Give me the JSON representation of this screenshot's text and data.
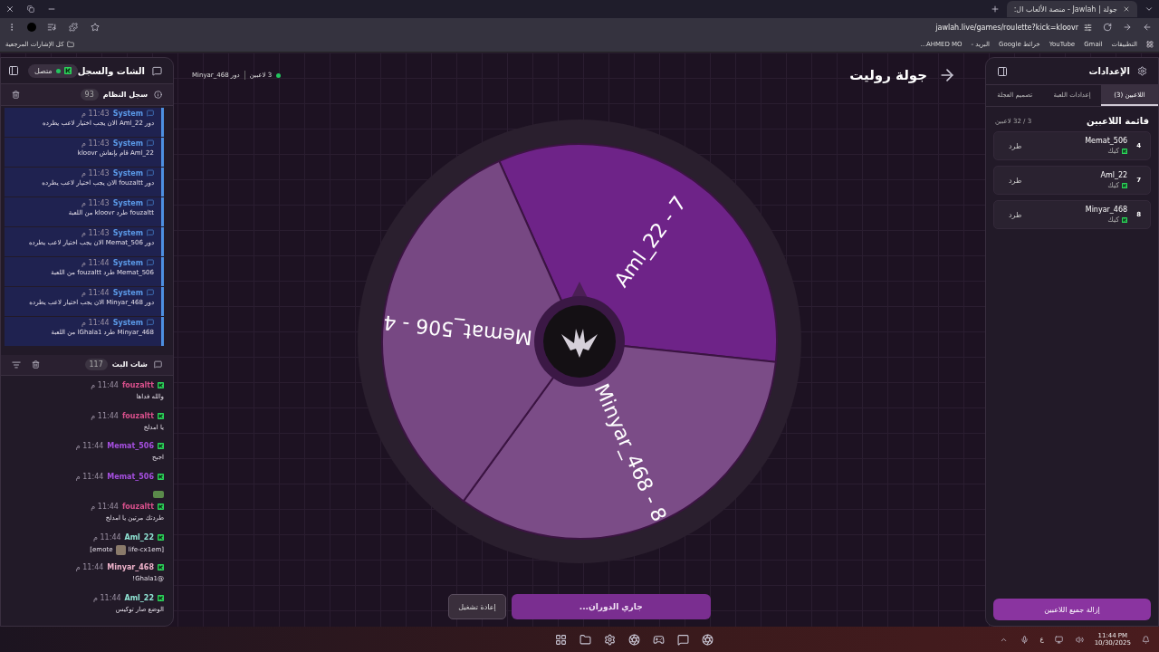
{
  "browser": {
    "tabs": [
      {
        "title": "جولة | Jawlah - منصة الألعاب ال:",
        "selected": true
      }
    ],
    "url": "jawlah.live/games/roulette?kick=kloovr",
    "bookmarks": [
      "التطبيقات",
      "Gmail",
      "YouTube",
      "خرائط Google",
      "البريد -",
      "AHMED MO..."
    ],
    "all_bookmarks": "كل الإشارات المرجعية"
  },
  "left_panel": {
    "title": "الشات والسجل",
    "status": "متصل",
    "system_log": {
      "title": "سجل النظام",
      "count": "93",
      "entries": [
        {
          "author": "System",
          "time": "11:43 م",
          "text": "دور Aml_22 الان يجب اختيار لاعب يطرده"
        },
        {
          "author": "System",
          "time": "11:43 م",
          "text": "Aml_22 قام بإنعاش kloovr"
        },
        {
          "author": "System",
          "time": "11:43 م",
          "text": "دور fouzaltt الان يجب اختيار لاعب يطرده"
        },
        {
          "author": "System",
          "time": "11:43 م",
          "text": "fouzaltt طرد kloovr من اللعبة"
        },
        {
          "author": "System",
          "time": "11:43 م",
          "text": "دور Memat_506 الان يجب اختيار لاعب يطرده"
        },
        {
          "author": "System",
          "time": "11:44 م",
          "text": "Memat_506 طرد fouzaltt من اللعبة"
        },
        {
          "author": "System",
          "time": "11:44 م",
          "text": "دور Minyar_468 الان يجب اختيار لاعب يطرده"
        },
        {
          "author": "System",
          "time": "11:44 م",
          "text": "Minyar_468 طرد lGhala1 من اللعبة"
        }
      ]
    },
    "chat": {
      "title": "شات البث",
      "count": "117",
      "messages": [
        {
          "kind": "text",
          "author": "fouzaltt",
          "color": "#d9508c",
          "time": "11:44 م",
          "text": "والله فداها"
        },
        {
          "kind": "text",
          "author": "fouzaltt",
          "color": "#d9508c",
          "time": "11:44 م",
          "text": "يا امدلخ"
        },
        {
          "kind": "text",
          "author": "Memat_506",
          "color": "#a64fe0",
          "time": "11:44 م",
          "text": "اجبح"
        },
        {
          "kind": "emote",
          "author": "Memat_506",
          "color": "#a64fe0",
          "time": "11:44 م"
        },
        {
          "kind": "text",
          "author": "fouzaltt",
          "color": "#d9508c",
          "time": "11:44 م",
          "text": "طردتك مرتين يا امدلخ"
        },
        {
          "kind": "emote_text",
          "author": "Aml_22",
          "color": "#8fe3d3",
          "time": "11:44 م",
          "before": "[emote",
          "after": "life-cx1em]"
        },
        {
          "kind": "text",
          "author": "Minyar_468",
          "color": "#f0b4cc",
          "time": "11:44 م",
          "text": "@Ghala1!"
        },
        {
          "kind": "text",
          "author": "Aml_22",
          "color": "#8fe3d3",
          "time": "11:44 م",
          "text": "الوضع صار توكيس"
        }
      ]
    }
  },
  "center": {
    "title": "جولة روليت",
    "players_count": "3 لاعبين",
    "turn": "دور Minyar_468",
    "wheel": {
      "segments": [
        {
          "label": "Aml_22 - 7",
          "color": "#6e2388"
        },
        {
          "label": "Minyar_468 - 8",
          "color": "#7b4c87"
        },
        {
          "label": "Memat_506 - 4",
          "color": "#774883"
        }
      ]
    },
    "restart_button": "إعادة تشغيل",
    "spin_button": "جاري الدوران..."
  },
  "right_panel": {
    "title": "الإعدادات",
    "tabs": [
      {
        "label": "اللاعبين (3)",
        "selected": true
      },
      {
        "label": "إعدادات اللعبة",
        "selected": false
      },
      {
        "label": "تصميم العجلة",
        "selected": false
      }
    ],
    "list_title": "قائمة اللاعبين",
    "capacity": "3 / 32 لاعبين",
    "players": [
      {
        "number": "4",
        "name": "Memat_506",
        "platform": "كيك",
        "action": "طرد"
      },
      {
        "number": "7",
        "name": "Aml_22",
        "platform": "كيك",
        "action": "طرد"
      },
      {
        "number": "8",
        "name": "Minyar_468",
        "platform": "كيك",
        "action": "طرد"
      }
    ],
    "remove_all": "إزالة جميع اللاعبين"
  },
  "taskbar": {
    "language": "ع",
    "time": "11:44 PM",
    "date": "10/30/2025"
  }
}
